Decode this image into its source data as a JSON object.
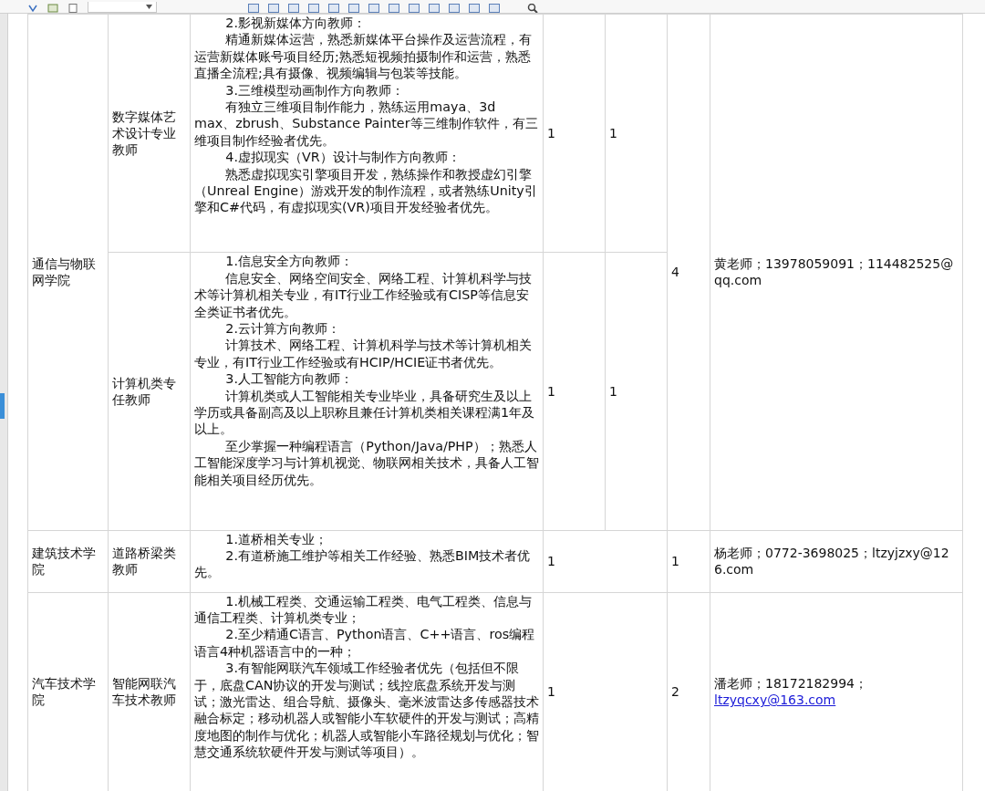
{
  "groups": [
    {
      "college": "通信与物联网学院",
      "total": "4",
      "contact": {
        "label": "黄老师；13978059091；114482525@qq.com"
      },
      "positions": [
        {
          "title": "数字媒体艺术设计专业教师",
          "counts": [
            "1",
            "1"
          ],
          "requirements": [
            "2.影视新媒体方向教师：",
            "精通新媒体运营，熟悉新媒体平台操作及运营流程，有运营新媒体账号项目经历;熟悉短视频拍摄制作和运营，熟悉直播全流程;具有摄像、视频编辑与包装等技能。",
            "3.三维模型动画制作方向教师：",
            "有独立三维项目制作能力，熟练运用maya、3d max、zbrush、Substance Painter等三维制作软件，有三维项目制作经验者优先。",
            "4.虚拟现实（VR）设计与制作方向教师：",
            "熟悉虚拟现实引擎项目开发，熟练操作和教授虚幻引擎（Unreal Engine）游戏开发的制作流程，或者熟练Unity引擎和C#代码，有虚拟现实(VR)项目开发经验者优先。"
          ]
        },
        {
          "title": "计算机类专任教师",
          "counts": [
            "1",
            "1"
          ],
          "requirements": [
            "1.信息安全方向教师：",
            "信息安全、网络空间安全、网络工程、计算机科学与技术等计算机相关专业，有IT行业工作经验或有CISP等信息安全类证书者优先。",
            "2.云计算方向教师：",
            "计算技术、网络工程、计算机科学与技术等计算机相关专业，有IT行业工作经验或有HCIP/HCIE证书者优先。",
            "3.人工智能方向教师：",
            "计算机类或人工智能相关专业毕业，具备研究生及以上学历或具备副高及以上职称且兼任计算机类相关课程满1年及以上。",
            "至少掌握一种编程语言（Python/Java/PHP）；熟悉人工智能深度学习与计算机视觉、物联网相关技术，具备人工智能相关项目经历优先。"
          ]
        }
      ]
    },
    {
      "college": "建筑技术学院",
      "total": "1",
      "contact": {
        "label": "杨老师；0772-3698025；ltzyjzxy@126.com"
      },
      "positions": [
        {
          "title": "道路桥梁类教师",
          "counts": [
            "1"
          ],
          "requirements": [
            "1.道桥相关专业；",
            "2.有道桥施工维护等相关工作经验、熟悉BIM技术者优先。"
          ]
        }
      ]
    },
    {
      "college": "汽车技术学院",
      "total": "2",
      "contact": {
        "label": "潘老师；18172182994；",
        "email": "ltzyqcxy@163.com"
      },
      "positions": [
        {
          "title": "智能网联汽车技术教师",
          "counts": [
            "1"
          ],
          "requirements": [
            "1.机械工程类、交通运输工程类、电气工程类、信息与通信工程类、计算机类专业；",
            "2.至少精通C语言、Python语言、C++语言、ros编程语言4种机器语言中的一种；",
            "3.有智能网联汽车领域工作经验者优先（包括但不限于，底盘CAN协议的开发与测试；线控底盘系统开发与测试；激光雷达、组合导航、摄像头、毫米波雷达多传感器技术融合标定；移动机器人或智能小车软硬件的开发与测试；高精度地图的制作与优化；机器人或智能小车路径规划与优化；智慧交通系统软硬件开发与测试等项目）。"
          ]
        }
      ]
    }
  ]
}
